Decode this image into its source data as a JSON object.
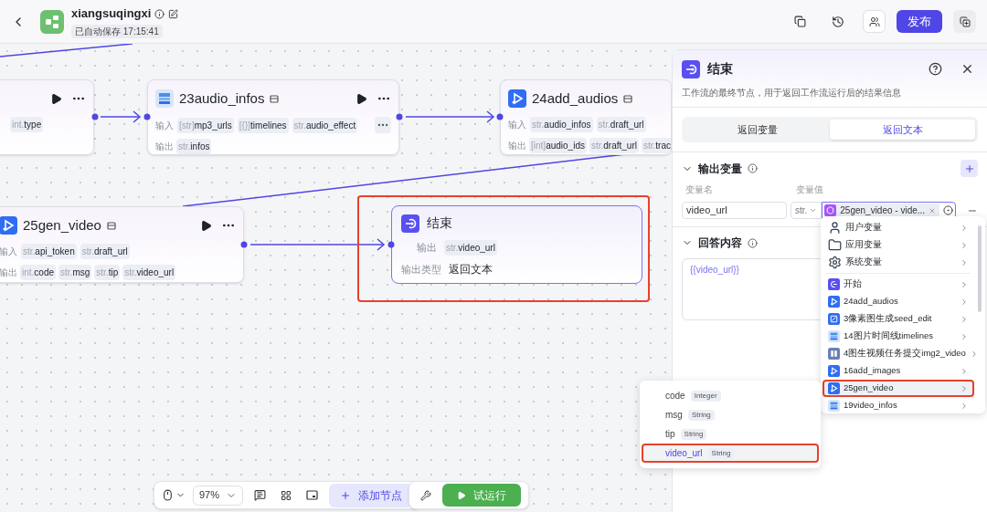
{
  "header": {
    "title": "xiangsuqingxi",
    "saved": "已自动保存 17:15:41",
    "publish": "发布"
  },
  "nodes": [
    {
      "kind": "partial",
      "inputs": [
        {
          "type": "int.",
          "name": "type"
        }
      ]
    },
    {
      "kind": "audio",
      "title": "23audio_infos",
      "input_label": "输入",
      "inputs": [
        {
          "type": "[str]",
          "name": "mp3_urls"
        },
        {
          "type": "[{}]",
          "name": "timelines"
        },
        {
          "type": "str.",
          "name": "audio_effect"
        }
      ],
      "more": true,
      "output_label": "输出",
      "outputs": [
        {
          "type": "str.",
          "name": "infos"
        }
      ]
    },
    {
      "kind": "video",
      "title": "24add_audios",
      "input_label": "输入",
      "inputs": [
        {
          "type": "str.",
          "name": "audio_infos"
        },
        {
          "type": "str.",
          "name": "draft_url"
        }
      ],
      "output_label": "输出",
      "outputs": [
        {
          "type": "[int]",
          "name": "audio_ids"
        },
        {
          "type": "str.",
          "name": "draft_url"
        },
        {
          "type": "str.",
          "name": "trac"
        }
      ]
    },
    {
      "kind": "video",
      "title": "25gen_video",
      "input_label": "输入",
      "inputs": [
        {
          "type": "str.",
          "name": "api_token"
        },
        {
          "type": "str.",
          "name": "draft_url"
        }
      ],
      "output_label": "输出",
      "outputs": [
        {
          "type": "int.",
          "name": "code"
        },
        {
          "type": "str.",
          "name": "msg"
        },
        {
          "type": "str.",
          "name": "tip"
        },
        {
          "type": "str.",
          "name": "video_url"
        }
      ]
    }
  ],
  "end_node": {
    "title": "结束",
    "selected": true,
    "output_label": "输出",
    "output": {
      "type": "str.",
      "name": "video_url"
    },
    "type_label": "输出类型",
    "type_value": "返回文本"
  },
  "panel": {
    "title": "结束",
    "description": "工作流的最终节点，用于返回工作流运行后的结果信息",
    "tabs": [
      {
        "label": "返回变量",
        "selected": false
      },
      {
        "label": "返回文本",
        "selected": true
      }
    ],
    "output_section": "输出变量",
    "name_header": "变量名",
    "value_header": "变量值",
    "var_name": "video_url",
    "var_type": "str.",
    "var_ref": "25gen_video - vide...",
    "answer_section": "回答内容",
    "answer": "{{video_url}}"
  },
  "dropdown": [
    {
      "kind": "user",
      "label": "用户变量",
      "selected": false
    },
    {
      "kind": "folder",
      "label": "应用变量",
      "selected": false
    },
    {
      "kind": "gear",
      "label": "系统变量",
      "selected": false
    },
    {
      "kind": "start",
      "label": "开始",
      "selected": false
    },
    {
      "kind": "video",
      "label": "24add_audios",
      "selected": false
    },
    {
      "kind": "image",
      "label": "3像素图生成seed_edit",
      "selected": false
    },
    {
      "kind": "audio",
      "label": "14图片时间线timelines",
      "selected": false
    },
    {
      "kind": "grid",
      "label": "4图生视频任务提交img2_video",
      "selected": false
    },
    {
      "kind": "video",
      "label": "16add_images",
      "selected": false
    },
    {
      "kind": "video",
      "label": "25gen_video",
      "selected": true
    },
    {
      "kind": "audio",
      "label": "19video_infos",
      "selected": false
    }
  ],
  "submenu": [
    {
      "name": "code",
      "type": "Integer",
      "selected": false
    },
    {
      "name": "msg",
      "type": "String",
      "selected": false
    },
    {
      "name": "tip",
      "type": "String",
      "selected": false
    },
    {
      "name": "video_url",
      "type": "String",
      "selected": true
    }
  ],
  "toolbar": {
    "zoom": "97%",
    "add": "添加节点",
    "run": "试运行"
  }
}
